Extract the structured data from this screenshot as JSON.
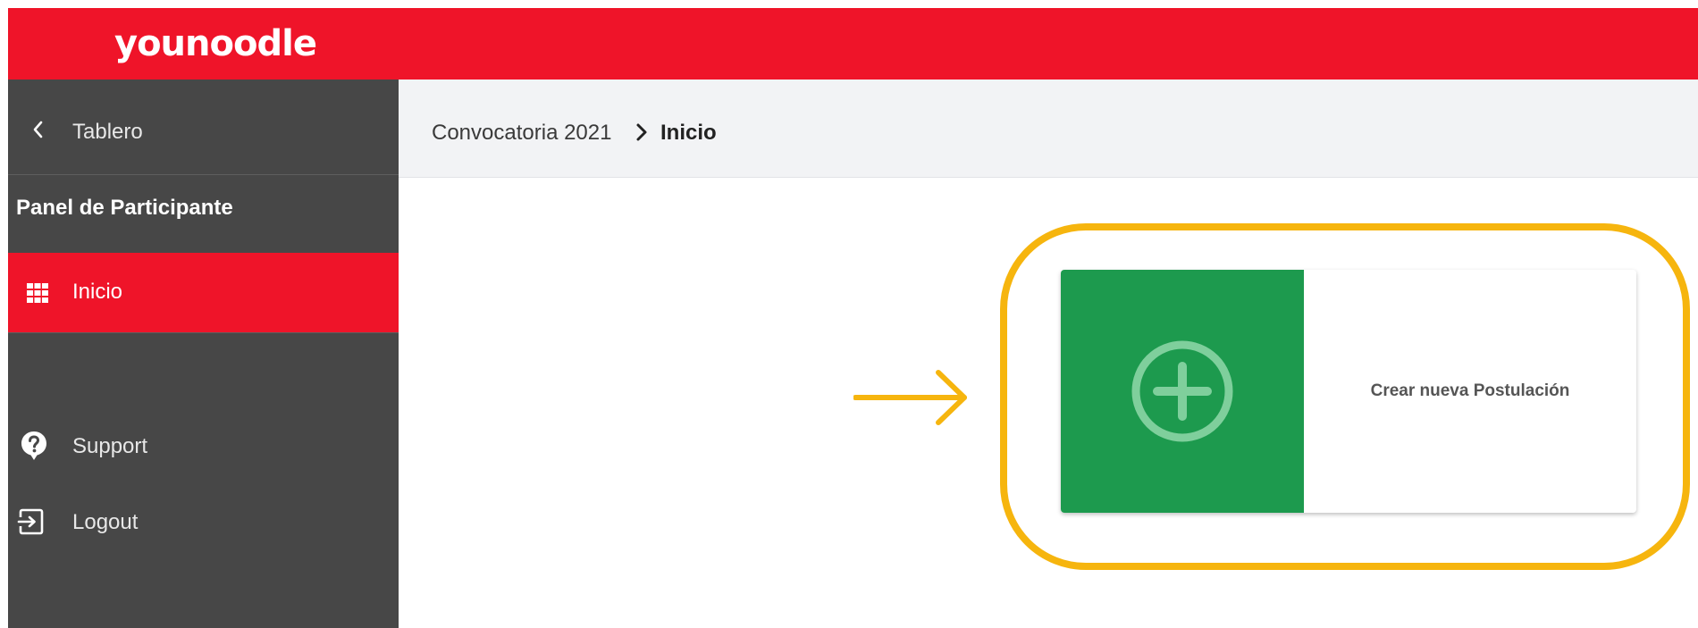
{
  "app": {
    "logo_text": "younoodle",
    "brand_color": "#ef1429"
  },
  "sidebar": {
    "back_label": "Tablero",
    "section_title": "Panel de Participante",
    "items": [
      {
        "label": "Inicio",
        "icon": "grid-icon",
        "active": true
      },
      {
        "label": "Support",
        "icon": "help-circle-icon",
        "active": false
      },
      {
        "label": "Logout",
        "icon": "logout-icon",
        "active": false
      }
    ]
  },
  "breadcrumb": {
    "items": [
      "Convocatoria 2021",
      "Inicio"
    ],
    "separator_icon": "chevron-right-icon"
  },
  "main": {
    "card": {
      "label": "Crear nueva Postulación",
      "icon": "plus-circle-icon",
      "accent_color": "#1d9a4e"
    }
  },
  "annotation": {
    "highlight_color": "#f6b50e",
    "arrow_icon": "arrow-right-icon"
  }
}
